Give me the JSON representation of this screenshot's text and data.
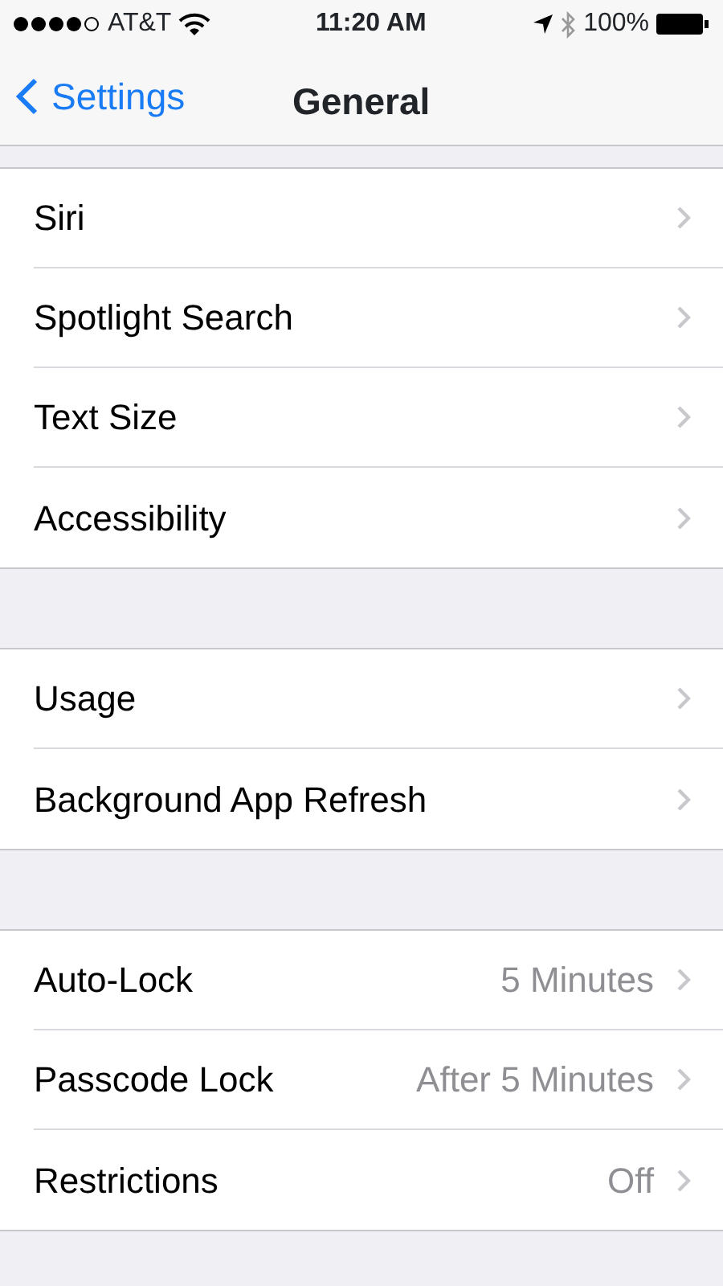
{
  "status_bar": {
    "carrier": "AT&T",
    "time": "11:20 AM",
    "battery": "100%"
  },
  "nav_bar": {
    "back": "Settings",
    "title": "General"
  },
  "groups": [
    {
      "rows": [
        {
          "label": "Siri"
        },
        {
          "label": "Spotlight Search"
        },
        {
          "label": "Text Size"
        },
        {
          "label": "Accessibility"
        }
      ]
    },
    {
      "rows": [
        {
          "label": "Usage"
        },
        {
          "label": "Background App Refresh"
        }
      ]
    },
    {
      "rows": [
        {
          "label": "Auto-Lock",
          "value": "5 Minutes"
        },
        {
          "label": "Passcode Lock",
          "value": "After 5 Minutes"
        },
        {
          "label": "Restrictions",
          "value": "Off"
        }
      ]
    }
  ]
}
